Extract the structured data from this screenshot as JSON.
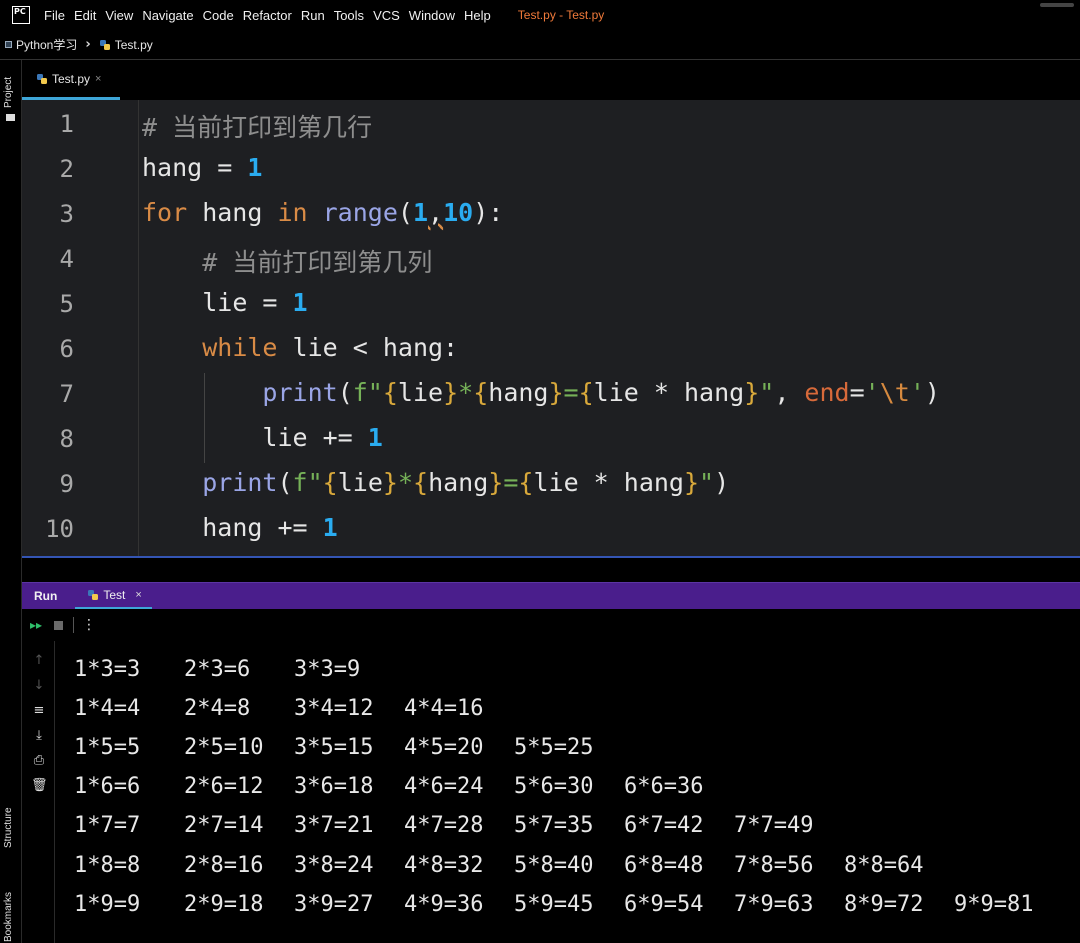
{
  "menubar": {
    "logo": "PC",
    "items": [
      "File",
      "Edit",
      "View",
      "Navigate",
      "Code",
      "Refactor",
      "Run",
      "Tools",
      "VCS",
      "Window",
      "Help"
    ],
    "window_title": "Test.py - Test.py"
  },
  "breadcrumb": {
    "project": "Python学习",
    "file": "Test.py"
  },
  "left_strip": {
    "project_label": "Project",
    "structure_label": "Structure",
    "bookmarks_label": "Bookmarks"
  },
  "editor": {
    "tab_label": "Test.py",
    "tab_close": "×",
    "line_numbers": [
      "1",
      "2",
      "3",
      "4",
      "5",
      "6",
      "7",
      "8",
      "9",
      "10"
    ]
  },
  "run": {
    "title": "Run",
    "tab_label": "Test",
    "tab_close": "×",
    "output": [
      [
        "1*3=3",
        "2*3=6",
        "3*3=9"
      ],
      [
        "1*4=4",
        "2*4=8",
        "3*4=12",
        "4*4=16"
      ],
      [
        "1*5=5",
        "2*5=10",
        "3*5=15",
        "4*5=20",
        "5*5=25"
      ],
      [
        "1*6=6",
        "2*6=12",
        "3*6=18",
        "4*6=24",
        "5*6=30",
        "6*6=36"
      ],
      [
        "1*7=7",
        "2*7=14",
        "3*7=21",
        "4*7=28",
        "5*7=35",
        "6*7=42",
        "7*7=49"
      ],
      [
        "1*8=8",
        "2*8=16",
        "3*8=24",
        "4*8=32",
        "5*8=40",
        "6*8=48",
        "7*8=56",
        "8*8=64"
      ],
      [
        "1*9=9",
        "2*9=18",
        "3*9=27",
        "4*9=36",
        "5*9=45",
        "6*9=54",
        "7*9=63",
        "8*9=72",
        "9*9=81"
      ]
    ]
  },
  "code": {
    "l1_comment": "# 当前打印到第几行",
    "l2_var": "hang",
    "l2_op": " = ",
    "l2_num": "1",
    "l3_for": "for",
    "l3_var": " hang ",
    "l3_in": "in",
    "l3_range": " range",
    "l3_open": "(",
    "l3_a": "1",
    "l3_comma": ",",
    "l3_b": "10",
    "l3_close": "):",
    "l4_comment": "# 当前打印到第几列",
    "l5_var": "lie",
    "l5_op": " = ",
    "l5_num": "1",
    "l6_while": "while",
    "l6_rest": " lie < hang:",
    "l7_print": "print",
    "l7_open": "(",
    "l7_f": "f\"",
    "l7_b1": "{",
    "l7_v1": "lie",
    "l7_b2": "}",
    "l7_star": "*",
    "l7_b3": "{",
    "l7_v2": "hang",
    "l7_b4": "}",
    "l7_eq": "=",
    "l7_b5": "{",
    "l7_v3": "lie * hang",
    "l7_b6": "}",
    "l7_q": "\"",
    "l7_comma": ", ",
    "l7_end": "end",
    "l7_eq2": "=",
    "l7_s1": "'",
    "l7_tab": "\\t",
    "l7_s2": "'",
    "l7_close": ")",
    "l8_var": "lie",
    "l8_op": " += ",
    "l8_num": "1",
    "l9_print": "print",
    "l9_open": "(",
    "l9_f": "f\"",
    "l9_b1": "{",
    "l9_v1": "lie",
    "l9_b2": "}",
    "l9_star": "*",
    "l9_b3": "{",
    "l9_v2": "hang",
    "l9_b4": "}",
    "l9_eq": "=",
    "l9_b5": "{",
    "l9_v3": "lie * hang",
    "l9_b6": "}",
    "l9_q": "\"",
    "l9_close": ")",
    "l10_var": "hang",
    "l10_op": " += ",
    "l10_num": "1"
  },
  "colors": {
    "run_header": "#4a1e8c",
    "tab_underline": "#3ea6d8",
    "keyword": "#d98b46",
    "number": "#2aacf0",
    "string": "#76b158"
  }
}
